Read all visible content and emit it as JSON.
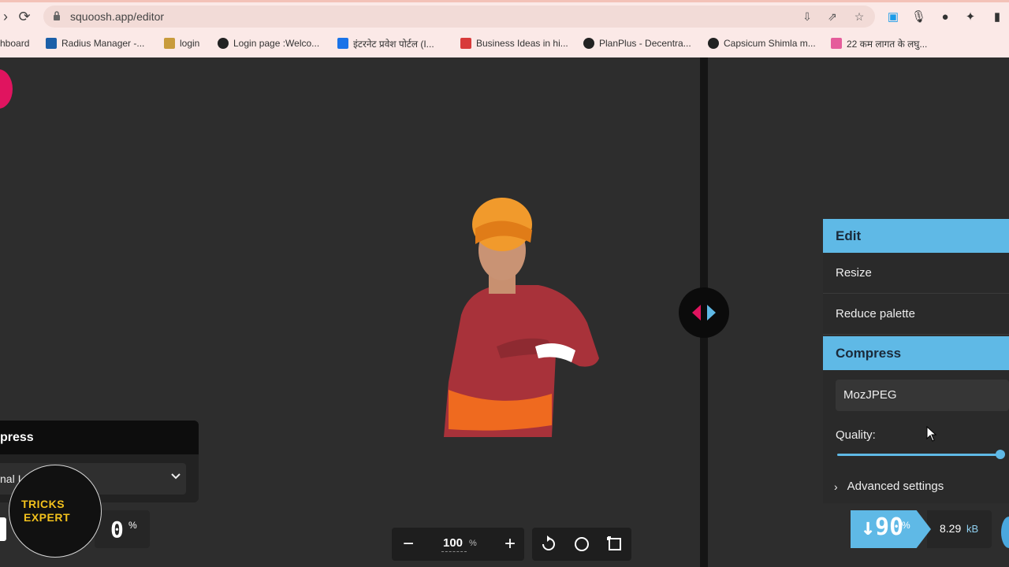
{
  "browser": {
    "url": "squoosh.app/editor",
    "bookmarks": [
      {
        "label": "hboard"
      },
      {
        "label": "Radius Manager -..."
      },
      {
        "label": "login"
      },
      {
        "label": "Login page :Welco..."
      },
      {
        "label": "इंटरनेट प्रवेश पोर्टल (I..."
      },
      {
        "label": "Business Ideas in hi..."
      },
      {
        "label": "PlanPlus - Decentra..."
      },
      {
        "label": "Capsicum Shimla m..."
      },
      {
        "label": "22 कम लागत के लघु..."
      }
    ]
  },
  "left_panel": {
    "title": "press",
    "select_value": "nal I",
    "percent": "0",
    "percent_sign": "%"
  },
  "right_panel": {
    "edit_header": "Edit",
    "items": [
      "Resize",
      "Reduce palette"
    ],
    "compress_header": "Compress",
    "encoder": "MozJPEG",
    "quality_label": "Quality:",
    "quality_fraction": 1.0,
    "advanced_label": "Advanced settings",
    "savings_percent": "↓90",
    "savings_sign": "%",
    "size_value": "8.29",
    "size_unit": "kB"
  },
  "zoom": {
    "value": "100",
    "unit": "%"
  },
  "watermark": {
    "line1": "TRICKS",
    "line2": "EXPERT"
  },
  "colors": {
    "accent": "#5fb9e6",
    "pink": "#e0145f"
  }
}
